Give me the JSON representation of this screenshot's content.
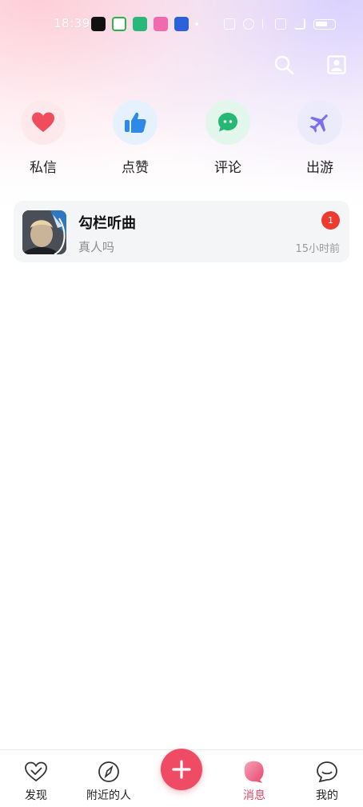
{
  "status_bar": {
    "time": "18:39",
    "app_icons": [
      {
        "name": "douyin-app-icon",
        "color": "#111111"
      },
      {
        "name": "video-app-icon",
        "color": "#2ab34a"
      },
      {
        "name": "message-app-icon",
        "color": "#28b97a"
      },
      {
        "name": "pink-app-icon",
        "color": "#f06ab0"
      },
      {
        "name": "blue-app-icon",
        "color": "#2c62d9"
      }
    ]
  },
  "quick_actions": [
    {
      "label": "私信",
      "icon": "heart-icon",
      "bg": "#fde9ec",
      "color": "#ef4d5c"
    },
    {
      "label": "点赞",
      "icon": "thumbs-up-icon",
      "bg": "#e5f2fd",
      "color": "#2f8ae7"
    },
    {
      "label": "评论",
      "icon": "chat-bubble-icon",
      "bg": "#e3f6ec",
      "color": "#25b873"
    },
    {
      "label": "出游",
      "icon": "airplane-icon",
      "bg": "#ecebfc",
      "color": "#7d6ef0"
    }
  ],
  "conversations": [
    {
      "name": "勾栏听曲",
      "last_message": "真人吗",
      "time": "15小时前",
      "unread": "1"
    }
  ],
  "tabs": [
    {
      "label": "发现",
      "icon": "heart-outline-icon"
    },
    {
      "label": "附近的人",
      "icon": "compass-icon"
    },
    {
      "label": "消息",
      "icon": "message-icon",
      "active": true
    },
    {
      "label": "我的",
      "icon": "profile-bubble-icon"
    }
  ],
  "colors": {
    "accent": "#f04b64",
    "active_tab": "#e8456c",
    "badge": "#ee3b2f"
  }
}
